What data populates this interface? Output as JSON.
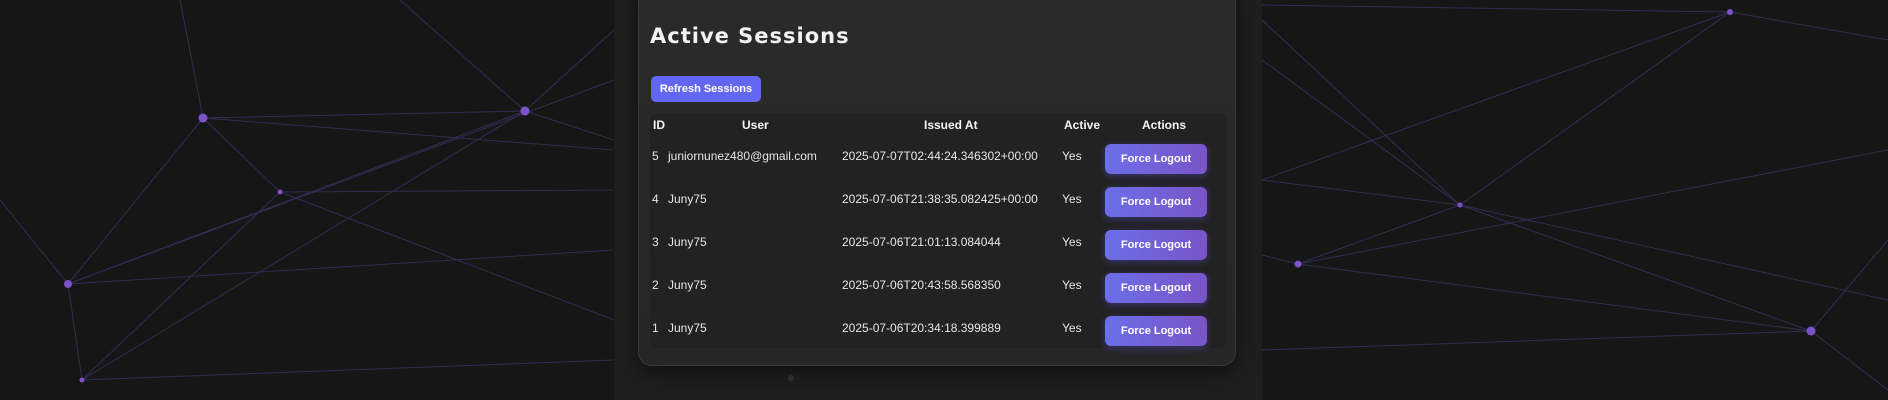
{
  "sessions": {
    "title": "Active Sessions",
    "refresh_label": "Refresh Sessions",
    "columns": {
      "id": "ID",
      "user": "User",
      "issued_at": "Issued At",
      "active": "Active",
      "actions": "Actions"
    },
    "rows": [
      {
        "id": "5",
        "user": "juniornunez480@gmail.com",
        "issued_at": "2025-07-07T02:44:24.346302+00:00",
        "active": "Yes",
        "action": "Force Logout"
      },
      {
        "id": "4",
        "user": "Juny75",
        "issued_at": "2025-07-06T21:38:35.082425+00:00",
        "active": "Yes",
        "action": "Force Logout"
      },
      {
        "id": "3",
        "user": "Juny75",
        "issued_at": "2025-07-06T21:01:13.084044",
        "active": "Yes",
        "action": "Force Logout"
      },
      {
        "id": "2",
        "user": "Juny75",
        "issued_at": "2025-07-06T20:43:58.568350",
        "active": "Yes",
        "action": "Force Logout"
      },
      {
        "id": "1",
        "user": "Juny75",
        "issued_at": "2025-07-06T20:34:18.399889",
        "active": "Yes",
        "action": "Force Logout"
      }
    ]
  },
  "colors": {
    "accent": "#6366f1",
    "logout_gradient_start": "#6b6ee8",
    "logout_gradient_end": "#7a55c8",
    "network_node": "#7b55c8",
    "network_line": "#3b3566"
  }
}
